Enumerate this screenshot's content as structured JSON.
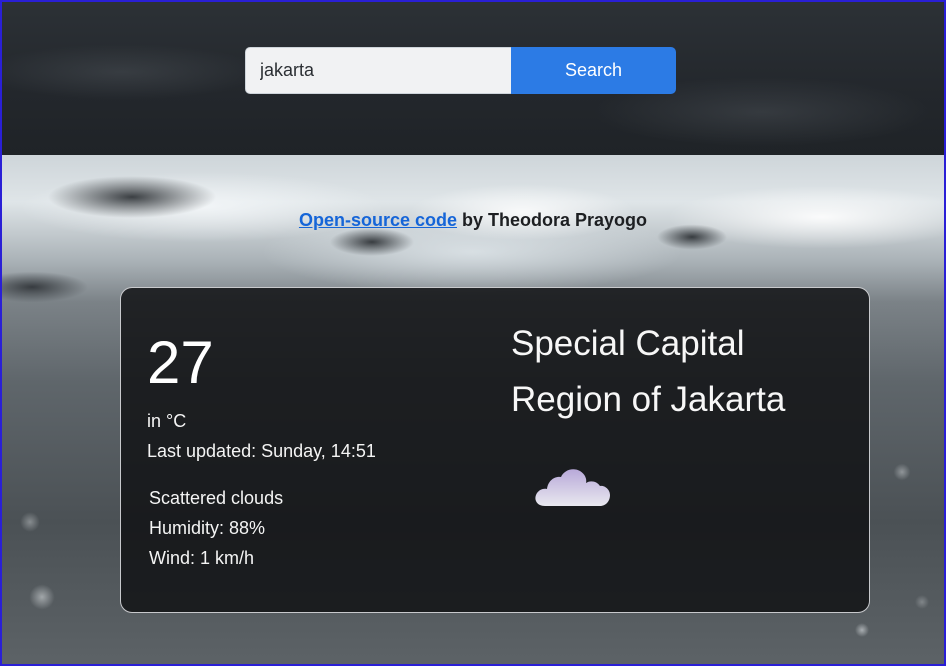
{
  "search": {
    "value": "jakarta",
    "button_label": "Search"
  },
  "credit": {
    "link_text": "Open-source code",
    "suffix": " by Theodora Prayogo"
  },
  "weather": {
    "temperature": "27",
    "unit_label": "in °C",
    "last_updated": "Last updated: Sunday, 14:51",
    "description": "Scattered clouds",
    "humidity": "Humidity: 88%",
    "wind": "Wind: 1 km/h",
    "city": "Special Capital Region of Jakarta",
    "icon": "cloud-icon"
  },
  "colors": {
    "accent": "#2c7be5",
    "link": "#1565d8",
    "card_background": "#121315",
    "cloud": "#c9c3dc"
  }
}
